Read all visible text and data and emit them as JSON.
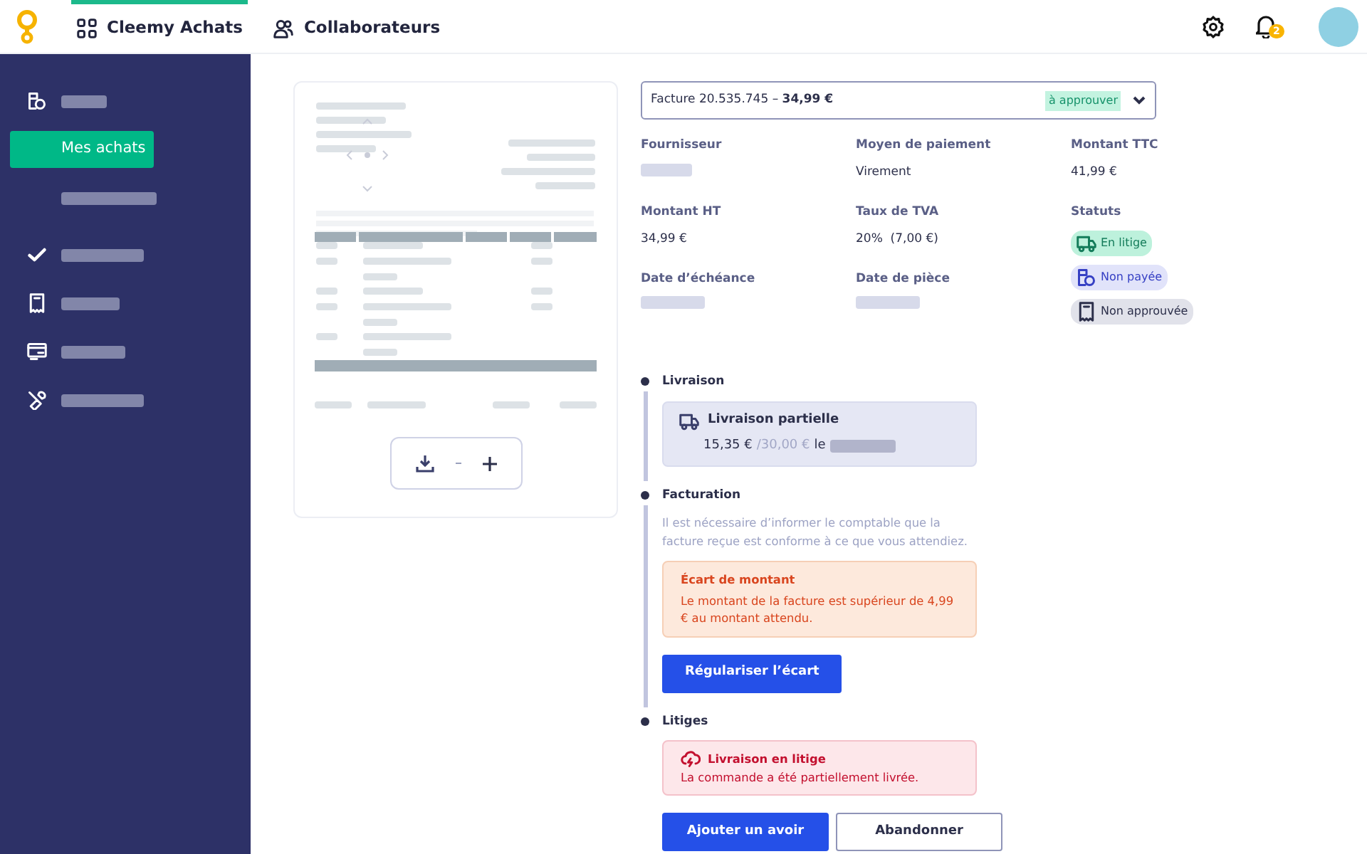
{
  "top_nav": {
    "tabs": [
      {
        "label": "Cleemy Achats",
        "selected": true
      },
      {
        "label": "Collaborateurs",
        "selected": false
      }
    ],
    "notification_count": "2"
  },
  "sidebar": {
    "items": [
      {
        "kind": "redacted",
        "selected": false
      },
      {
        "kind": "text",
        "label": "Mes achats",
        "selected": true
      },
      {
        "kind": "redacted",
        "selected": false
      },
      {
        "kind": "redacted",
        "selected": false
      },
      {
        "kind": "redacted",
        "selected": false
      },
      {
        "kind": "redacted",
        "selected": false
      },
      {
        "kind": "redacted",
        "selected": false
      }
    ]
  },
  "invoice_select": {
    "title": "Facture 20.535.745 – **34,99 €**",
    "badge": "à approuver"
  },
  "fields": [
    [
      {
        "label": "Fournisseur",
        "kind": "redacted"
      },
      {
        "label": "Montant HT",
        "kind": "text",
        "value": "34,99 €"
      },
      {
        "label": "Date d’échéance",
        "kind": "redacted"
      }
    ],
    [
      {
        "label": "Moyen de paiement",
        "kind": "text",
        "value": "Virement"
      },
      {
        "label": "Taux de TVA",
        "kind": "text",
        "value": "20%  (7,00 €)"
      },
      {
        "label": "Date de pièce",
        "kind": "redacted"
      }
    ],
    [
      {
        "label": "Montant TTC",
        "kind": "text",
        "value": "41,99 €"
      },
      {
        "label": "Statuts",
        "kind": "statuses"
      }
    ]
  ],
  "statuses": [
    {
      "label": "En litige",
      "kind": "success"
    },
    {
      "label": "Non payée",
      "kind": "info"
    },
    {
      "label": "Non approuvée",
      "kind": "neutral"
    }
  ],
  "timeline": [
    {
      "title": "Livraison",
      "kind": "delivery",
      "card_title": "Livraison partielle",
      "amount": "15,35 €",
      "total": "/30,00 €",
      "suffix": "le"
    },
    {
      "title": "Facturation",
      "kind": "billing",
      "description": "Il est nécessaire d’informer le comptable que la facture reçue est conforme à ce que vous attendiez.",
      "alert_title": "Écart de montant",
      "alert_text": "Le montant de la facture est supérieur de 4,99 € au montant attendu.",
      "button": "Régulariser l’écart"
    },
    {
      "title": "Litiges",
      "kind": "dispute",
      "card_title": "Livraison en litige",
      "card_text": "La commande a été partiellement livrée."
    }
  ],
  "actions": [
    {
      "label": "Ajouter un avoir",
      "kind": "primary"
    },
    {
      "label": "Abandonner",
      "kind": "outline"
    }
  ]
}
